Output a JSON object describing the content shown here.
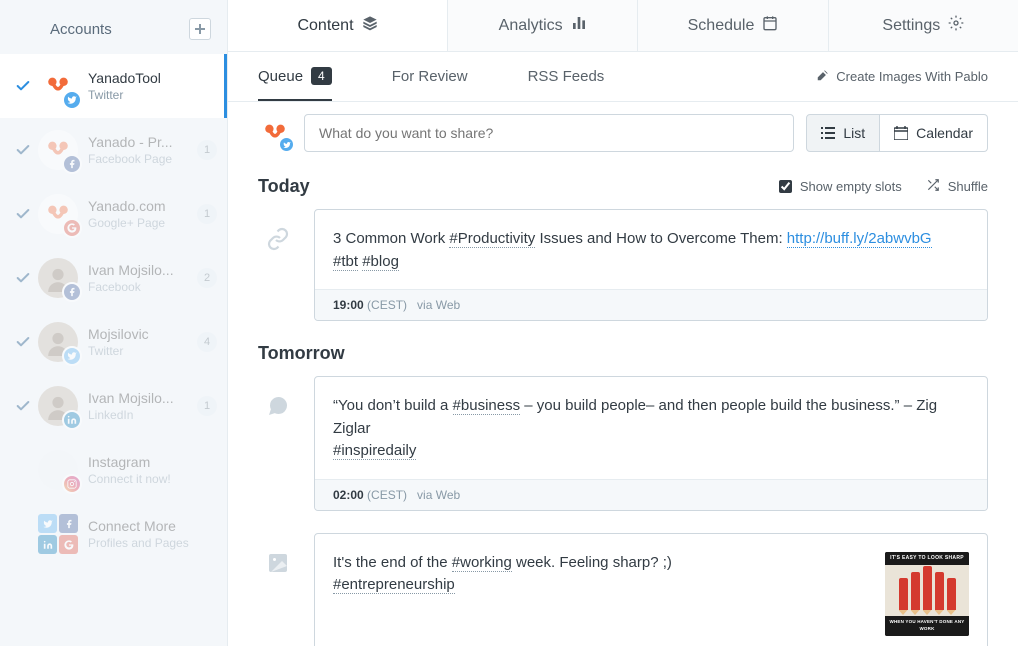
{
  "sidebar": {
    "title": "Accounts",
    "accounts": [
      {
        "name": "YanadoTool",
        "sub": "Twitter",
        "network": "twitter",
        "count": null,
        "active": true,
        "avatar": "yana"
      },
      {
        "name": "Yanado - Pr...",
        "sub": "Facebook Page",
        "network": "facebook",
        "count": "1",
        "active": false,
        "avatar": "yana"
      },
      {
        "name": "Yanado.com",
        "sub": "Google+ Page",
        "network": "google",
        "count": "1",
        "active": false,
        "avatar": "yana"
      },
      {
        "name": "Ivan Mojsilo...",
        "sub": "Facebook",
        "network": "facebook",
        "count": "2",
        "active": false,
        "avatar": "person"
      },
      {
        "name": "Mojsilovic",
        "sub": "Twitter",
        "network": "twitter",
        "count": "4",
        "active": false,
        "avatar": "person"
      },
      {
        "name": "Ivan Mojsilo...",
        "sub": "LinkedIn",
        "network": "linkedin",
        "count": "1",
        "active": false,
        "avatar": "person"
      },
      {
        "name": "Instagram",
        "sub": "Connect it now!",
        "network": "instagram",
        "count": null,
        "active": false,
        "avatar": "empty",
        "nocheck": true
      },
      {
        "name": "Connect More",
        "sub": "Profiles and Pages",
        "network": "multi",
        "count": null,
        "active": false,
        "avatar": "multi",
        "nocheck": true
      }
    ]
  },
  "top_tabs": [
    {
      "label": "Content",
      "icon": "stack",
      "active": true
    },
    {
      "label": "Analytics",
      "icon": "bars",
      "active": false
    },
    {
      "label": "Schedule",
      "icon": "calendar",
      "active": false
    },
    {
      "label": "Settings",
      "icon": "gear",
      "active": false
    }
  ],
  "sub_tabs": {
    "items": [
      {
        "label": "Queue",
        "count": "4",
        "active": true
      },
      {
        "label": "For Review",
        "active": false
      },
      {
        "label": "RSS Feeds",
        "active": false
      }
    ],
    "pablo": "Create Images With Pablo"
  },
  "composer": {
    "placeholder": "What do you want to share?",
    "list_btn": "List",
    "calendar_btn": "Calendar"
  },
  "sections": [
    {
      "title": "Today",
      "show_opts": true,
      "show_empty": "Show empty slots",
      "shuffle": "Shuffle",
      "posts": [
        {
          "icon": "link",
          "segments": [
            {
              "t": "3 Common Work "
            },
            {
              "t": "#Productivity",
              "h": true
            },
            {
              "t": " Issues and How to Overcome Them: "
            },
            {
              "t": "http://buff.ly/2abwvbG",
              "l": true
            },
            {
              "br": true
            },
            {
              "t": "#tbt",
              "h": true
            },
            {
              "t": " "
            },
            {
              "t": "#blog",
              "h": true
            }
          ],
          "time": "19:00",
          "tz": "(CEST)",
          "via": "via Web"
        }
      ]
    },
    {
      "title": "Tomorrow",
      "show_opts": false,
      "posts": [
        {
          "icon": "chat",
          "segments": [
            {
              "t": "“You don’t build a "
            },
            {
              "t": "#business",
              "h": true
            },
            {
              "t": " – you build people– and then people build the business.” – Zig Ziglar"
            },
            {
              "br": true
            },
            {
              "t": "#inspiredaily",
              "h": true
            }
          ],
          "time": "02:00",
          "tz": "(CEST)",
          "via": "via Web"
        },
        {
          "icon": "image",
          "segments": [
            {
              "t": "It's the end of the "
            },
            {
              "t": "#working",
              "h": true
            },
            {
              "t": " week. Feeling sharp? ;)"
            },
            {
              "br": true
            },
            {
              "t": "#entrepreneurship",
              "h": true
            }
          ],
          "thumb": {
            "top": "IT'S EASY TO LOOK SHARP",
            "bot": "WHEN YOU HAVEN'T DONE ANY WORK"
          },
          "no_footer": true
        }
      ]
    }
  ]
}
